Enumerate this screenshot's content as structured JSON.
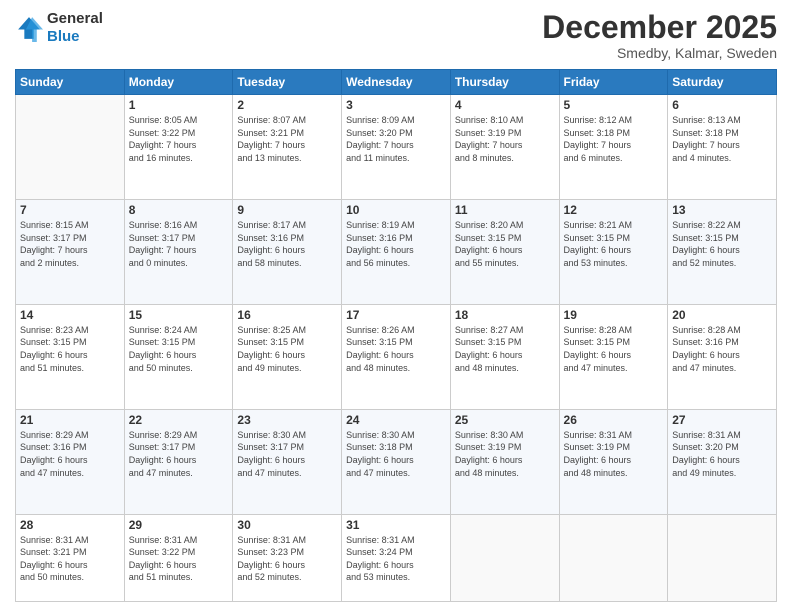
{
  "logo": {
    "line1": "General",
    "line2": "Blue"
  },
  "header": {
    "month": "December 2025",
    "location": "Smedby, Kalmar, Sweden"
  },
  "days_of_week": [
    "Sunday",
    "Monday",
    "Tuesday",
    "Wednesday",
    "Thursday",
    "Friday",
    "Saturday"
  ],
  "weeks": [
    [
      {
        "day": "",
        "info": ""
      },
      {
        "day": "1",
        "info": "Sunrise: 8:05 AM\nSunset: 3:22 PM\nDaylight: 7 hours\nand 16 minutes."
      },
      {
        "day": "2",
        "info": "Sunrise: 8:07 AM\nSunset: 3:21 PM\nDaylight: 7 hours\nand 13 minutes."
      },
      {
        "day": "3",
        "info": "Sunrise: 8:09 AM\nSunset: 3:20 PM\nDaylight: 7 hours\nand 11 minutes."
      },
      {
        "day": "4",
        "info": "Sunrise: 8:10 AM\nSunset: 3:19 PM\nDaylight: 7 hours\nand 8 minutes."
      },
      {
        "day": "5",
        "info": "Sunrise: 8:12 AM\nSunset: 3:18 PM\nDaylight: 7 hours\nand 6 minutes."
      },
      {
        "day": "6",
        "info": "Sunrise: 8:13 AM\nSunset: 3:18 PM\nDaylight: 7 hours\nand 4 minutes."
      }
    ],
    [
      {
        "day": "7",
        "info": "Sunrise: 8:15 AM\nSunset: 3:17 PM\nDaylight: 7 hours\nand 2 minutes."
      },
      {
        "day": "8",
        "info": "Sunrise: 8:16 AM\nSunset: 3:17 PM\nDaylight: 7 hours\nand 0 minutes."
      },
      {
        "day": "9",
        "info": "Sunrise: 8:17 AM\nSunset: 3:16 PM\nDaylight: 6 hours\nand 58 minutes."
      },
      {
        "day": "10",
        "info": "Sunrise: 8:19 AM\nSunset: 3:16 PM\nDaylight: 6 hours\nand 56 minutes."
      },
      {
        "day": "11",
        "info": "Sunrise: 8:20 AM\nSunset: 3:15 PM\nDaylight: 6 hours\nand 55 minutes."
      },
      {
        "day": "12",
        "info": "Sunrise: 8:21 AM\nSunset: 3:15 PM\nDaylight: 6 hours\nand 53 minutes."
      },
      {
        "day": "13",
        "info": "Sunrise: 8:22 AM\nSunset: 3:15 PM\nDaylight: 6 hours\nand 52 minutes."
      }
    ],
    [
      {
        "day": "14",
        "info": "Sunrise: 8:23 AM\nSunset: 3:15 PM\nDaylight: 6 hours\nand 51 minutes."
      },
      {
        "day": "15",
        "info": "Sunrise: 8:24 AM\nSunset: 3:15 PM\nDaylight: 6 hours\nand 50 minutes."
      },
      {
        "day": "16",
        "info": "Sunrise: 8:25 AM\nSunset: 3:15 PM\nDaylight: 6 hours\nand 49 minutes."
      },
      {
        "day": "17",
        "info": "Sunrise: 8:26 AM\nSunset: 3:15 PM\nDaylight: 6 hours\nand 48 minutes."
      },
      {
        "day": "18",
        "info": "Sunrise: 8:27 AM\nSunset: 3:15 PM\nDaylight: 6 hours\nand 48 minutes."
      },
      {
        "day": "19",
        "info": "Sunrise: 8:28 AM\nSunset: 3:15 PM\nDaylight: 6 hours\nand 47 minutes."
      },
      {
        "day": "20",
        "info": "Sunrise: 8:28 AM\nSunset: 3:16 PM\nDaylight: 6 hours\nand 47 minutes."
      }
    ],
    [
      {
        "day": "21",
        "info": "Sunrise: 8:29 AM\nSunset: 3:16 PM\nDaylight: 6 hours\nand 47 minutes."
      },
      {
        "day": "22",
        "info": "Sunrise: 8:29 AM\nSunset: 3:17 PM\nDaylight: 6 hours\nand 47 minutes."
      },
      {
        "day": "23",
        "info": "Sunrise: 8:30 AM\nSunset: 3:17 PM\nDaylight: 6 hours\nand 47 minutes."
      },
      {
        "day": "24",
        "info": "Sunrise: 8:30 AM\nSunset: 3:18 PM\nDaylight: 6 hours\nand 47 minutes."
      },
      {
        "day": "25",
        "info": "Sunrise: 8:30 AM\nSunset: 3:19 PM\nDaylight: 6 hours\nand 48 minutes."
      },
      {
        "day": "26",
        "info": "Sunrise: 8:31 AM\nSunset: 3:19 PM\nDaylight: 6 hours\nand 48 minutes."
      },
      {
        "day": "27",
        "info": "Sunrise: 8:31 AM\nSunset: 3:20 PM\nDaylight: 6 hours\nand 49 minutes."
      }
    ],
    [
      {
        "day": "28",
        "info": "Sunrise: 8:31 AM\nSunset: 3:21 PM\nDaylight: 6 hours\nand 50 minutes."
      },
      {
        "day": "29",
        "info": "Sunrise: 8:31 AM\nSunset: 3:22 PM\nDaylight: 6 hours\nand 51 minutes."
      },
      {
        "day": "30",
        "info": "Sunrise: 8:31 AM\nSunset: 3:23 PM\nDaylight: 6 hours\nand 52 minutes."
      },
      {
        "day": "31",
        "info": "Sunrise: 8:31 AM\nSunset: 3:24 PM\nDaylight: 6 hours\nand 53 minutes."
      },
      {
        "day": "",
        "info": ""
      },
      {
        "day": "",
        "info": ""
      },
      {
        "day": "",
        "info": ""
      }
    ]
  ]
}
